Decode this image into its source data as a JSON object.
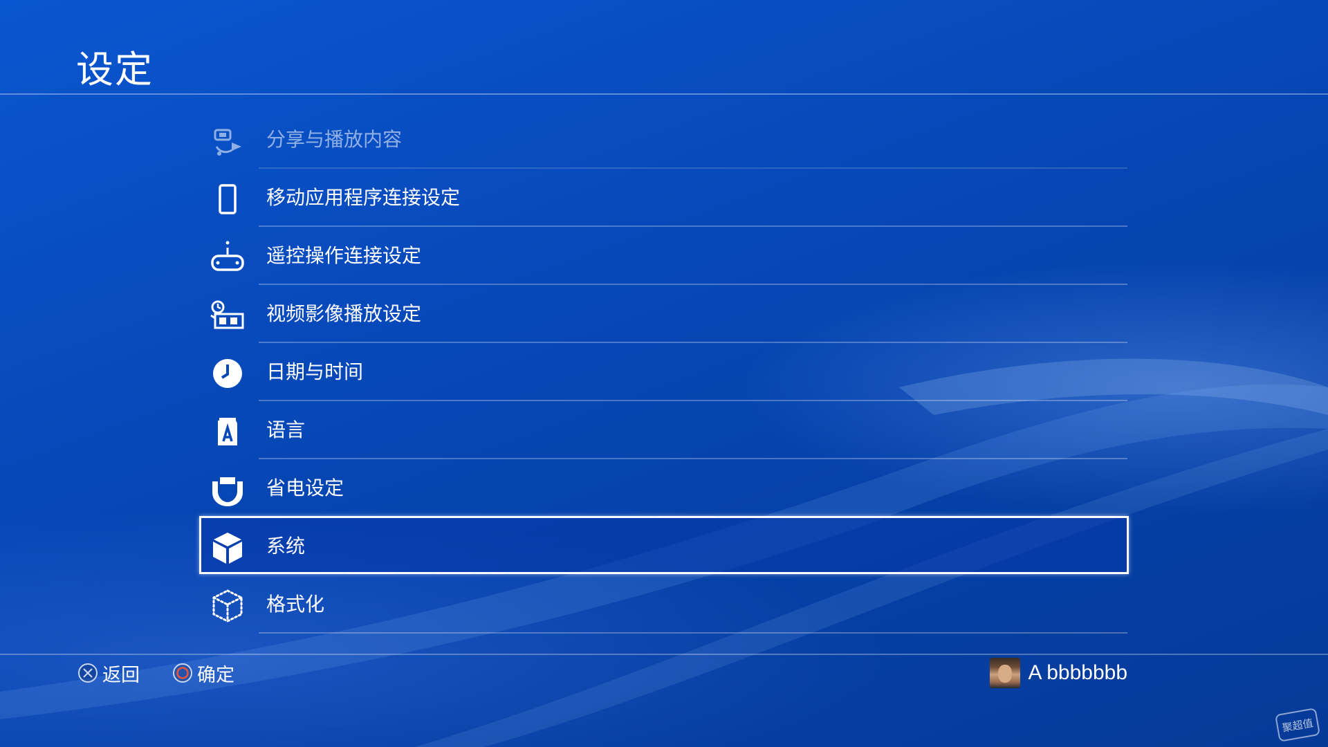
{
  "header": {
    "title": "设定"
  },
  "menu": {
    "items": [
      {
        "label": "分享与播放内容",
        "icon": "share-play-icon",
        "state": "faded"
      },
      {
        "label": "移动应用程序连接设定",
        "icon": "mobile-phone-icon"
      },
      {
        "label": "遥控操作连接设定",
        "icon": "remote-play-icon"
      },
      {
        "label": "视频影像播放设定",
        "icon": "video-playback-icon"
      },
      {
        "label": "日期与时间",
        "icon": "clock-icon"
      },
      {
        "label": "语言",
        "icon": "language-icon"
      },
      {
        "label": "省电设定",
        "icon": "power-save-icon"
      },
      {
        "label": "系统",
        "icon": "system-cube-icon",
        "state": "selected"
      },
      {
        "label": "格式化",
        "icon": "format-dotted-cube-icon"
      }
    ]
  },
  "footer": {
    "back_label": "返回",
    "back_icon": "cross-button-icon",
    "confirm_label": "确定",
    "confirm_icon": "circle-button-icon",
    "user_name": "A bbbbbbb"
  },
  "watermark": {
    "text": "聚超值"
  },
  "colors": {
    "background": "#0748b8",
    "circle_button": "#e8533e",
    "text": "#ffffff"
  }
}
